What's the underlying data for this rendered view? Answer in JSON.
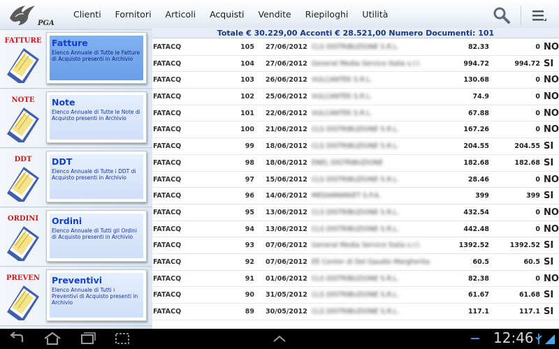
{
  "app": {
    "logo_text": "PGA"
  },
  "tabs": [
    {
      "label": "Clienti",
      "active": false
    },
    {
      "label": "Fornitori",
      "active": false
    },
    {
      "label": "Articoli",
      "active": false
    },
    {
      "label": "Acquisti",
      "active": true
    },
    {
      "label": "Vendite",
      "active": false
    },
    {
      "label": "Riepiloghi",
      "active": false
    },
    {
      "label": "Utilità",
      "active": false
    }
  ],
  "toolbar": {
    "search_icon": "search-icon",
    "menu_icon": "overflow-menu-icon"
  },
  "sidebar": {
    "items": [
      {
        "icon_label": "FATTURE",
        "title": "Fatture",
        "description": "Elenco Annuale di Tutte le Fatture di Acquisto presenti in Archivio",
        "selected": true
      },
      {
        "icon_label": "NOTE",
        "title": "Note",
        "description": "Elenco Annuale di Tutte le Note di Acquisto presenti in Archivio",
        "selected": false
      },
      {
        "icon_label": "DDT",
        "title": "DDT",
        "description": "Elenco Annuale di Tutte i DDT di Acquisto presenti in Archivio",
        "selected": false
      },
      {
        "icon_label": "ORDINI",
        "title": "Ordini",
        "description": "Elenco Annuale di Tutti gli Ordini di Acquisto presenti in Archivio",
        "selected": false
      },
      {
        "icon_label": "PREVEN",
        "title": "Preventivi",
        "description": "Elenco Annuale di Tutti i Preventivi di Acquisto presenti in Archivio",
        "selected": false
      }
    ]
  },
  "summary": {
    "text": "Totale € 30.229,00 Acconti € 28.521,00 Numero Documenti: 101"
  },
  "table": {
    "rows": [
      {
        "tipo": "FATACQ",
        "num": "105",
        "date": "27/06/2012",
        "name": "CLS DISTRIBUZIONE S.R.L.",
        "amount": "82.33",
        "acconto": "0",
        "flag": "NO"
      },
      {
        "tipo": "FATACQ",
        "num": "104",
        "date": "27/06/2012",
        "name": "General Media Service Italia s.r.l.",
        "amount": "994.72",
        "acconto": "994.72",
        "flag": "SI"
      },
      {
        "tipo": "FATACQ",
        "num": "103",
        "date": "26/06/2012",
        "name": "VULCANTEK S.R.L.",
        "amount": "130.68",
        "acconto": "0",
        "flag": "NO"
      },
      {
        "tipo": "FATACQ",
        "num": "102",
        "date": "25/06/2012",
        "name": "VULCANTEK S.R.L.",
        "amount": "74.9",
        "acconto": "0",
        "flag": "NO"
      },
      {
        "tipo": "FATACQ",
        "num": "101",
        "date": "22/06/2012",
        "name": "VULCANTEK S.R.L.",
        "amount": "67.88",
        "acconto": "0",
        "flag": "NO"
      },
      {
        "tipo": "FATACQ",
        "num": "100",
        "date": "21/06/2012",
        "name": "CLS DISTRIBUZIONE S.R.L.",
        "amount": "167.26",
        "acconto": "0",
        "flag": "NO"
      },
      {
        "tipo": "FATACQ",
        "num": "99",
        "date": "18/06/2012",
        "name": "CLS DISTRIBUZIONE S.R.L.",
        "amount": "204.55",
        "acconto": "204.55",
        "flag": "SI"
      },
      {
        "tipo": "FATACQ",
        "num": "98",
        "date": "18/06/2012",
        "name": "ENEL DISTRIBUZIONE",
        "amount": "182.68",
        "acconto": "182.68",
        "flag": "SI"
      },
      {
        "tipo": "FATACQ",
        "num": "97",
        "date": "15/06/2012",
        "name": "CLS DISTRIBUZIONE S.R.L.",
        "amount": "28.46",
        "acconto": "0",
        "flag": "NO"
      },
      {
        "tipo": "FATACQ",
        "num": "96",
        "date": "14/06/2012",
        "name": "MEDIAMARKET S.P.A.",
        "amount": "399",
        "acconto": "399",
        "flag": "SI"
      },
      {
        "tipo": "FATACQ",
        "num": "95",
        "date": "13/06/2012",
        "name": "CLS DISTRIBUZIONE S.R.L.",
        "amount": "432.54",
        "acconto": "0",
        "flag": "NO"
      },
      {
        "tipo": "FATACQ",
        "num": "94",
        "date": "13/06/2012",
        "name": "CLS DISTRIBUZIONE S.R.L.",
        "amount": "442.48",
        "acconto": "0",
        "flag": "NO"
      },
      {
        "tipo": "FATACQ",
        "num": "93",
        "date": "07/06/2012",
        "name": "General Media Service Italia s.r.l.",
        "amount": "1392.52",
        "acconto": "1392.52",
        "flag": "SI"
      },
      {
        "tipo": "FATACQ",
        "num": "92",
        "date": "07/06/2012",
        "name": "EE Center di Del Gaudio Margherita",
        "amount": "60.5",
        "acconto": "60.5",
        "flag": "SI"
      },
      {
        "tipo": "FATACQ",
        "num": "91",
        "date": "01/06/2012",
        "name": "CLS DISTRIBUZIONE S.R.L.",
        "amount": "82.38",
        "acconto": "0",
        "flag": "NO"
      },
      {
        "tipo": "FATACQ",
        "num": "90",
        "date": "31/05/2012",
        "name": "CLS DISTRIBUZIONE S.R.L.",
        "amount": "61.67",
        "acconto": "61.68",
        "flag": "SI"
      },
      {
        "tipo": "FATACQ",
        "num": "89",
        "date": "30/05/2012",
        "name": "CLS DISTRIBUZIONE S.R.L.",
        "amount": "117.1",
        "acconto": "117.1",
        "flag": "SI"
      }
    ]
  },
  "system": {
    "clock": "12:46",
    "back_icon": "back-icon",
    "home_icon": "home-icon",
    "recent_icon": "recent-apps-icon",
    "screenshot_icon": "screenshot-icon",
    "up_icon": "chevron-up-icon"
  }
}
